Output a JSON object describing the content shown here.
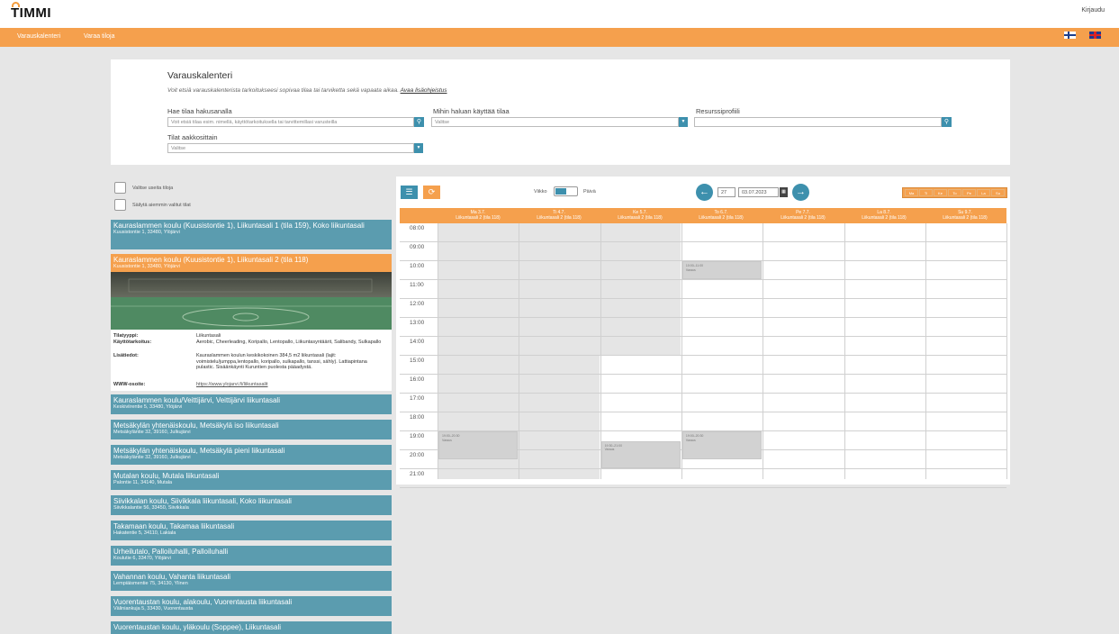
{
  "app": {
    "logo": "TIMMI",
    "login": "Kirjaudu"
  },
  "nav": {
    "items": [
      "Varauskalenteri",
      "Varaa tiloja"
    ]
  },
  "header": {
    "title": "Varauskalenteri",
    "intro": "Voit etsiä varauskalenterista tarkoitukseesi sopivaa tilaa tai tarviketta sekä vapaata aikaa.",
    "intro_link": "Avaa lisäohjeistus"
  },
  "search": {
    "label": "Hae tilaa hakusanalla",
    "placeholder": "Voit etsiä tilaa esim. nimellä, käyttötarkoituksella tai tarvittemillasi varusteilla"
  },
  "usage": {
    "label": "Mihin haluan käyttää tilaa",
    "value": "Valitse"
  },
  "profile": {
    "label": "Resurssiprofiili",
    "value": ""
  },
  "alpha": {
    "label": "Tilat aakkosittain",
    "value": "Valitse"
  },
  "options": {
    "multi": "Valitse useita tiloja",
    "keep": "Säilytä aiemmin valitut tilat"
  },
  "locations": [
    {
      "name": "Kauraslammen koulu (Kuusistontie 1), Liikuntasali 1 (tila 159), Koko liikuntasali",
      "address": "Kuusistontie 1, 33480, Ylöjärvi"
    },
    {
      "name": "Kauraslammen koulu (Kuusistontie 1), Liikuntasali 2 (tila 118)",
      "address": "Kuusistontie 1, 33480, Ylöjärvi"
    },
    {
      "name": "Kauraslammen koulu/Veittijärvi, Veittijärvi liikuntasali",
      "address": "Keskiviirentie 5, 33480, Ylöjärvi"
    },
    {
      "name": "Metsäkylän yhtenäiskoulu, Metsäkylä iso liikuntasali",
      "address": "Metsäkyläntie 32, 39160, Julkujärvi"
    },
    {
      "name": "Metsäkylän yhtenäiskoulu, Metsäkylä pieni liikuntasali",
      "address": "Metsäkyläntie 32, 39160, Julkujärvi"
    },
    {
      "name": "Mutalan koulu, Mutala liikuntasali",
      "address": "Palontie 11, 34140, Mutala"
    },
    {
      "name": "Siivikkalan koulu, Siivikkala liikuntasali, Koko liikuntasali",
      "address": "Siivikkalantie 56, 33450, Siivikkala"
    },
    {
      "name": "Takamaan koulu, Takamaa liikuntasali",
      "address": "Hakatentie 5, 34110, Lakiala"
    },
    {
      "name": "Urheilutalo, Palloiluhalli, Palloiluhalli",
      "address": "Koulutie 6, 33470, Ylöjärvi"
    },
    {
      "name": "Vahannan koulu, Vahanta liikuntasali",
      "address": "Lempiäismentie 75, 34130, Ylinen"
    },
    {
      "name": "Vuorentaustan koulu, alakoulu, Vuorentausta liikuntasali",
      "address": "Väliniankuja 5, 33430, Vuorentausta"
    },
    {
      "name": "Vuorentaustan koulu, yläkoulu (Soppee), Liikuntasali",
      "address": ""
    }
  ],
  "detail": {
    "type_label": "Tilatyyppi:",
    "type": "Liikuntasali",
    "use_label": "Käyttötarkoitus:",
    "use": "Aerobic, Cheerleading, Koripallo, Lentopallo, Liikuntasyntäärit, Salibandy, Sulkapallo",
    "info_label": "Lisätiedot:",
    "info": "Kauraslammen koulun keskikokoinen 384,5 m2 liikuntasali (lajit: voimistelu/jumppa,lentopallo, koripallo, sulkapallo, tanssi, sähly). Lattiapintana pulastic. Sisäänkäynti Kuruntien puolesta pääadystä.",
    "www_label": "WWW-osoite:",
    "www": "https://www.ylojarvi.fi/liikuntasalit"
  },
  "calendar": {
    "toggle_week": "Viikko",
    "toggle_day": "Päivä",
    "week_num": "27",
    "date": "03.07.2023",
    "day_buttons": [
      "Ma",
      "Ti",
      "Ke",
      "To",
      "Pe",
      "La",
      "Su"
    ],
    "columns": [
      {
        "day": "Ma 3.7.",
        "room": "Liikuntasali 2 (tila 118)"
      },
      {
        "day": "Ti 4.7.",
        "room": "Liikuntasali 2 (tila 118)"
      },
      {
        "day": "Ke 5.7.",
        "room": "Liikuntasali 2 (tila 118)"
      },
      {
        "day": "To 6.7.",
        "room": "Liikuntasali 2 (tila 118)"
      },
      {
        "day": "Pe 7.7.",
        "room": "Liikuntasali 2 (tila 118)"
      },
      {
        "day": "La 8.7.",
        "room": "Liikuntasali 2 (tila 118)"
      },
      {
        "day": "Su 9.7.",
        "room": "Liikuntasali 2 (tila 118)"
      }
    ],
    "hours": [
      "08:00",
      "09:00",
      "10:00",
      "11:00",
      "12:00",
      "13:00",
      "14:00",
      "15:00",
      "16:00",
      "17:00",
      "18:00",
      "19:00",
      "20:00",
      "21:00"
    ],
    "events": [
      {
        "day": 0,
        "start": 19,
        "end": 20.5,
        "time": "19:00–20:30",
        "label": "Varaus"
      },
      {
        "day": 2,
        "start": 19.5,
        "end": 21,
        "time": "19:30–21:00",
        "label": "Varaus"
      },
      {
        "day": 3,
        "start": 10,
        "end": 11,
        "time": "10:00–11:00",
        "label": "Varaus"
      },
      {
        "day": 3,
        "start": 19,
        "end": 20.5,
        "time": "19:00–20:30",
        "label": "Varaus"
      }
    ]
  }
}
